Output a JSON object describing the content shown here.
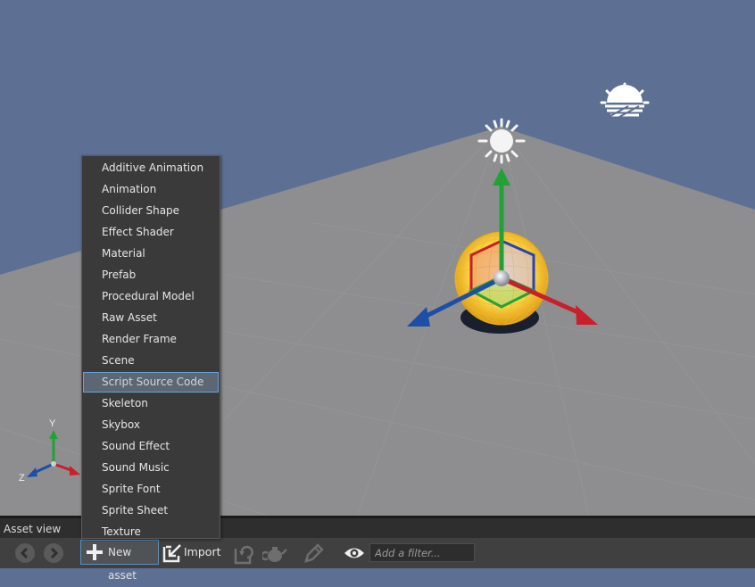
{
  "viewport": {
    "gizmo_axes": {
      "y": "Y",
      "z": "Z"
    },
    "colors": {
      "sky": "#5d6f93",
      "ground": "#8e8e90",
      "axis_x": "#c8202a",
      "axis_y": "#22a236",
      "axis_z": "#1d4fa6",
      "light_sphere": "#ffd84a"
    }
  },
  "new_asset_menu": {
    "items": [
      "Additive Animation",
      "Animation",
      "Collider Shape",
      "Effect Shader",
      "Material",
      "Prefab",
      "Procedural Model",
      "Raw Asset",
      "Render Frame",
      "Scene",
      "Script Source Code",
      "Skeleton",
      "Skybox",
      "Sound Effect",
      "Sound Music",
      "Sprite Font",
      "Sprite Sheet",
      "Texture"
    ],
    "highlighted_index": 10
  },
  "asset_panel": {
    "title": "Asset view",
    "toolbar": {
      "new_asset_label": "New asset",
      "import_label": "Import",
      "filter_placeholder": "Add a filter...",
      "icons": [
        "back-icon",
        "forward-icon",
        "plus-icon",
        "import-icon",
        "reimport-icon",
        "teapot-icon",
        "edit-icon",
        "eye-icon"
      ]
    }
  }
}
